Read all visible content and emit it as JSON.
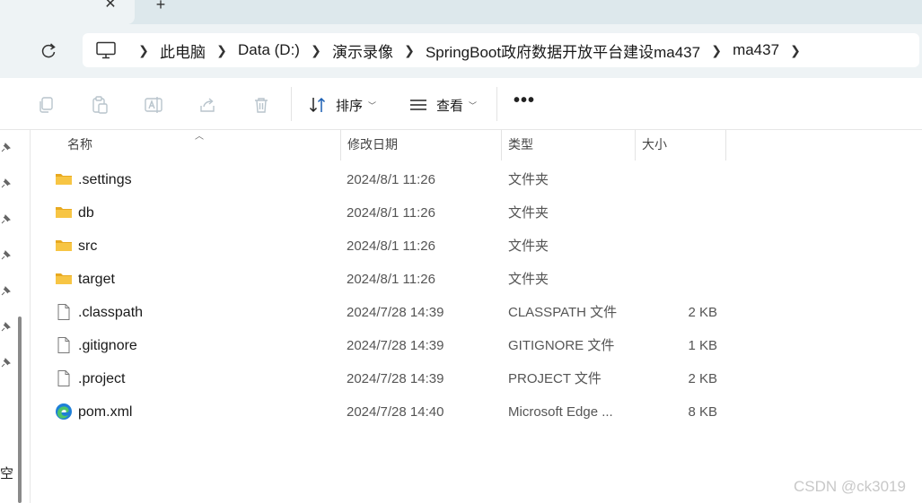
{
  "address": {
    "crumbs": [
      "此电脑",
      "Data (D:)",
      "演示录像",
      "SpringBoot政府数据开放平台建设ma437",
      "ma437"
    ]
  },
  "toolbar": {
    "sort_label": "排序",
    "view_label": "查看",
    "more_label": "•••"
  },
  "navpane": {
    "partial_label": "空"
  },
  "columns": {
    "name": "名称",
    "date": "修改日期",
    "type": "类型",
    "size": "大小"
  },
  "files": [
    {
      "name": ".settings",
      "date": "2024/8/1 11:26",
      "type": "文件夹",
      "size": "",
      "icon": "folder-icon"
    },
    {
      "name": "db",
      "date": "2024/8/1 11:26",
      "type": "文件夹",
      "size": "",
      "icon": "folder-icon"
    },
    {
      "name": "src",
      "date": "2024/8/1 11:26",
      "type": "文件夹",
      "size": "",
      "icon": "folder-icon"
    },
    {
      "name": "target",
      "date": "2024/8/1 11:26",
      "type": "文件夹",
      "size": "",
      "icon": "folder-icon"
    },
    {
      "name": ".classpath",
      "date": "2024/7/28 14:39",
      "type": "CLASSPATH 文件",
      "size": "2 KB",
      "icon": "file-icon"
    },
    {
      "name": ".gitignore",
      "date": "2024/7/28 14:39",
      "type": "GITIGNORE 文件",
      "size": "1 KB",
      "icon": "file-icon"
    },
    {
      "name": ".project",
      "date": "2024/7/28 14:39",
      "type": "PROJECT 文件",
      "size": "2 KB",
      "icon": "file-icon"
    },
    {
      "name": "pom.xml",
      "date": "2024/7/28 14:40",
      "type": "Microsoft Edge ...",
      "size": "8 KB",
      "icon": "edge-icon"
    }
  ],
  "watermark": "CSDN @ck3019",
  "colors": {
    "folder": "#f7c544",
    "folder_dark": "#e8a920",
    "chrome_bg": "#eef3f5",
    "tabstrip_bg": "#dde8ec"
  }
}
